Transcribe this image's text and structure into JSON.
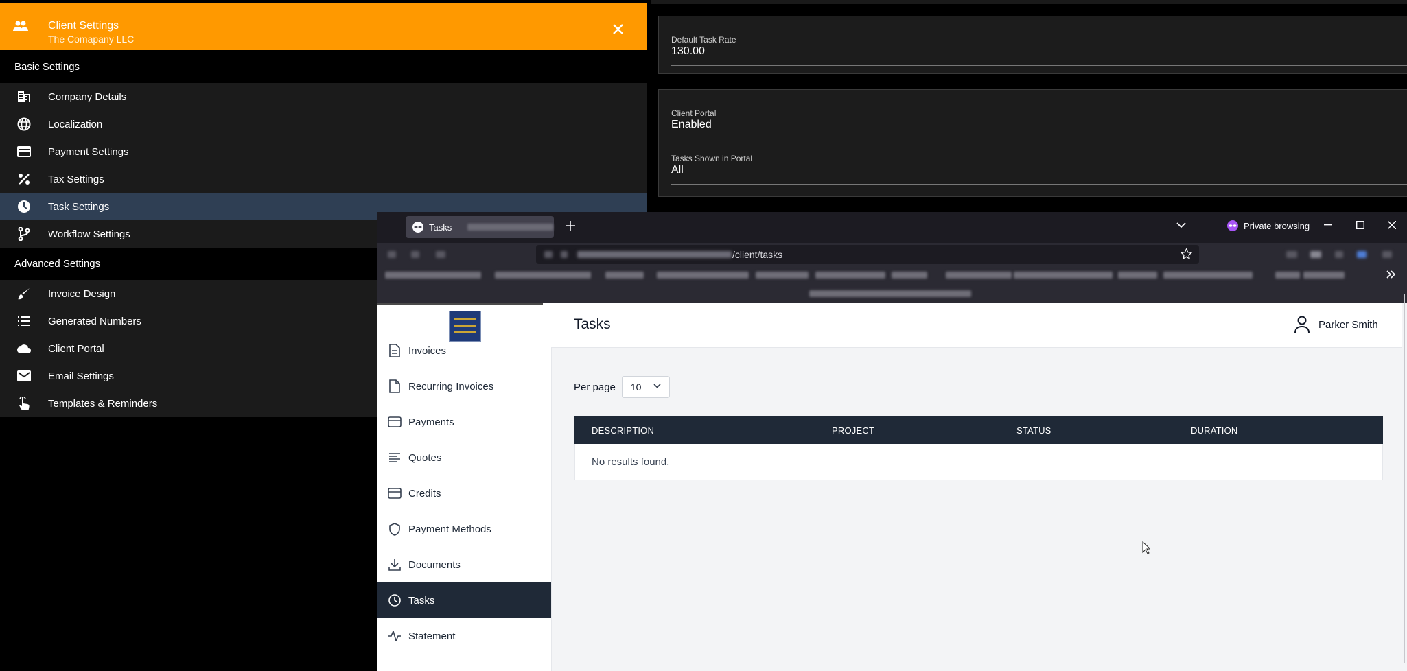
{
  "drawer": {
    "title": "Client Settings",
    "subtitle": "The Comapany LLC",
    "basic_title": "Basic Settings",
    "basic_items": [
      {
        "label": "Company Details",
        "icon": "business-icon"
      },
      {
        "label": "Localization",
        "icon": "globe-icon"
      },
      {
        "label": "Payment Settings",
        "icon": "credit-card-icon"
      },
      {
        "label": "Tax Settings",
        "icon": "percent-icon"
      },
      {
        "label": "Task Settings",
        "icon": "clock-icon",
        "active": true
      },
      {
        "label": "Workflow Settings",
        "icon": "git-branch-icon"
      }
    ],
    "advanced_title": "Advanced Settings",
    "advanced_items": [
      {
        "label": "Invoice Design",
        "icon": "brush-icon"
      },
      {
        "label": "Generated Numbers",
        "icon": "list-numbered-icon"
      },
      {
        "label": "Client Portal",
        "icon": "cloud-icon"
      },
      {
        "label": "Email Settings",
        "icon": "mail-icon"
      },
      {
        "label": "Templates & Reminders",
        "icon": "touch-app-icon"
      }
    ]
  },
  "settings_panel": {
    "default_task_rate": {
      "label": "Default Task Rate",
      "value": "130.00"
    },
    "client_portal": {
      "label": "Client Portal",
      "value": "Enabled"
    },
    "tasks_shown": {
      "label": "Tasks Shown in Portal",
      "value": "All"
    }
  },
  "browser": {
    "tab_title": "Tasks —",
    "private_label": "Private browsing",
    "url_path": "/client/tasks"
  },
  "portal": {
    "nav": [
      {
        "label": "Invoices",
        "icon": "document-icon"
      },
      {
        "label": "Recurring Invoices",
        "icon": "file-icon"
      },
      {
        "label": "Payments",
        "icon": "credit-card-icon"
      },
      {
        "label": "Quotes",
        "icon": "align-left-icon"
      },
      {
        "label": "Credits",
        "icon": "credit-card-icon"
      },
      {
        "label": "Payment Methods",
        "icon": "shield-icon"
      },
      {
        "label": "Documents",
        "icon": "download-icon"
      },
      {
        "label": "Tasks",
        "icon": "clock-icon",
        "active": true
      },
      {
        "label": "Statement",
        "icon": "activity-icon"
      }
    ],
    "page_title": "Tasks",
    "user_name": "Parker Smith",
    "per_page_label": "Per page",
    "per_page_value": "10",
    "table": {
      "columns": [
        "DESCRIPTION",
        "PROJECT",
        "STATUS",
        "DURATION"
      ],
      "empty_text": "No results found."
    }
  },
  "colors": {
    "drawer_header": "#ff9900",
    "active_setting": "#2f3f54",
    "portal_dark": "#1f2937"
  }
}
